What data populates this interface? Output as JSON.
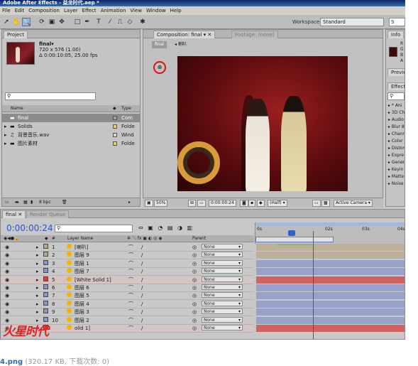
{
  "window": {
    "title": "Adobe After Effects - 益龙时代.aep *"
  },
  "menu": [
    "File",
    "Edit",
    "Composition",
    "Layer",
    "Effect",
    "Animation",
    "View",
    "Window",
    "Help"
  ],
  "workspace": {
    "label": "Workspace:",
    "value": "Standard",
    "search": "S"
  },
  "project": {
    "tab": "Project",
    "comp_name": "final▾",
    "comp_dims": "720 x 576 (1.00)",
    "comp_duration": "Δ 0:00:10:05, 25.00 fps",
    "search_placeholder": "",
    "col_name": "Name",
    "col_type": "Type",
    "items": [
      {
        "name": "final",
        "type": "Com",
        "swatch": "#a0a0a0"
      },
      {
        "name": "Solids",
        "type": "Folde",
        "swatch": "#e8d35a"
      },
      {
        "name": "背景音乐.wav",
        "type": "Wind",
        "swatch": "#d6d6d6"
      },
      {
        "name": "图片素材",
        "type": "Folde",
        "swatch": "#e8d35a"
      }
    ],
    "bpc": "8 bpc"
  },
  "composition": {
    "tab": "Composition: final",
    "footage_tab": "Footage: (none)",
    "breadcrumb_final": "final",
    "breadcrumb_next": "喇叭",
    "zoom": "50%",
    "timecode": "0:00:00:24",
    "resolution": "(Half)",
    "camera": "Active Camera"
  },
  "info": {
    "tab": "Info",
    "labels": [
      "R",
      "G",
      "B",
      "A"
    ],
    "preview_tab": "Previe",
    "effects_tab": "Effects",
    "effects_search": ""
  },
  "effects_list": [
    "* Ani",
    "3D Ch",
    "Audio",
    "Blur 8",
    "Chann",
    "Color",
    "Distor",
    "Expre",
    "Gener",
    "Keyin",
    "Matte",
    "Noise"
  ],
  "timeline": {
    "tab_final": "final",
    "tab_render": "Render Queue",
    "timecode": "0:00:00:24",
    "search": "",
    "col_num": "#",
    "col_layer": "Layer Name",
    "col_parent": "Parent",
    "ruler": [
      "0s",
      "02s",
      "03s",
      "04s"
    ],
    "layers": [
      {
        "num": "1",
        "name": "[喇叭]",
        "parent": "None",
        "color": "#b8a888"
      },
      {
        "num": "2",
        "name": "图层 9",
        "parent": "None",
        "color": "#b8a888"
      },
      {
        "num": "3",
        "name": "图层 1",
        "parent": "None",
        "color": "#8a94c8"
      },
      {
        "num": "4",
        "name": "图层 7",
        "parent": "None",
        "color": "#8a94c8"
      },
      {
        "num": "5",
        "name": "[White Solid 1]",
        "parent": "None",
        "color": "#d64040"
      },
      {
        "num": "6",
        "name": "图层 6",
        "parent": "None",
        "color": "#8a94c8"
      },
      {
        "num": "7",
        "name": "图层 5",
        "parent": "None",
        "color": "#8a94c8"
      },
      {
        "num": "8",
        "name": "图层 4",
        "parent": "None",
        "color": "#8a94c8"
      },
      {
        "num": "9",
        "name": "图层 3",
        "parent": "None",
        "color": "#8a94c8"
      },
      {
        "num": "10",
        "name": "图层 2",
        "parent": "None",
        "color": "#8a94c8"
      },
      {
        "num": "",
        "name": "olid 1]",
        "parent": "None",
        "color": "#d64040"
      }
    ]
  },
  "caption": {
    "filename": "4.png",
    "info": "(320.17 KB, 下载次数: 0)"
  },
  "watermark": "火星时代"
}
